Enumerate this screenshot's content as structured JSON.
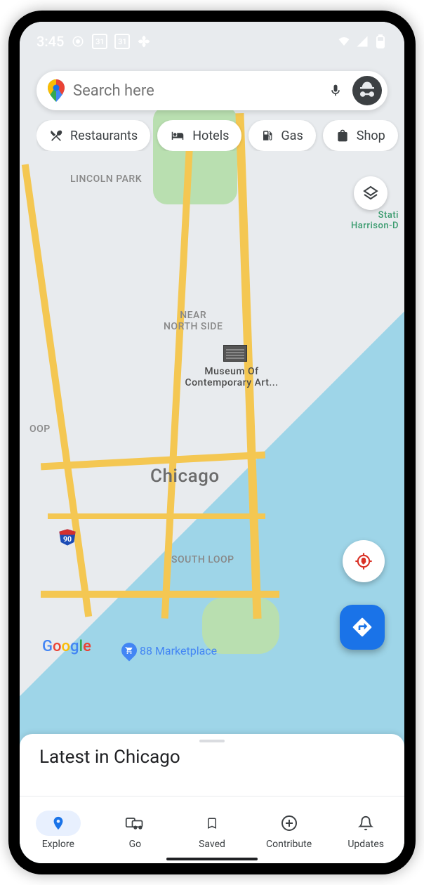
{
  "status": {
    "time": "3:45",
    "date_box": "31"
  },
  "search": {
    "placeholder": "Search here"
  },
  "chips": [
    {
      "icon": "restaurant-icon",
      "label": "Restaurants"
    },
    {
      "icon": "hotel-icon",
      "label": "Hotels"
    },
    {
      "icon": "gas-icon",
      "label": "Gas"
    },
    {
      "icon": "shopping-icon",
      "label": "Shop"
    }
  ],
  "map": {
    "neighborhoods": {
      "lincoln_park": "LINCOLN PARK",
      "near_north": "NEAR\nNORTH SIDE",
      "loop": "OOP",
      "south_loop": "SOUTH LOOP"
    },
    "city": "Chicago",
    "poi": {
      "museum": "Museum Of\nContemporary Art..."
    },
    "transit": "Stati\nHarrison-D",
    "shop_pin": "88 Marketplace",
    "logo": "Google"
  },
  "sheet": {
    "title": "Latest in Chicago"
  },
  "nav": {
    "explore": "Explore",
    "go": "Go",
    "saved": "Saved",
    "contribute": "Contribute",
    "updates": "Updates"
  }
}
